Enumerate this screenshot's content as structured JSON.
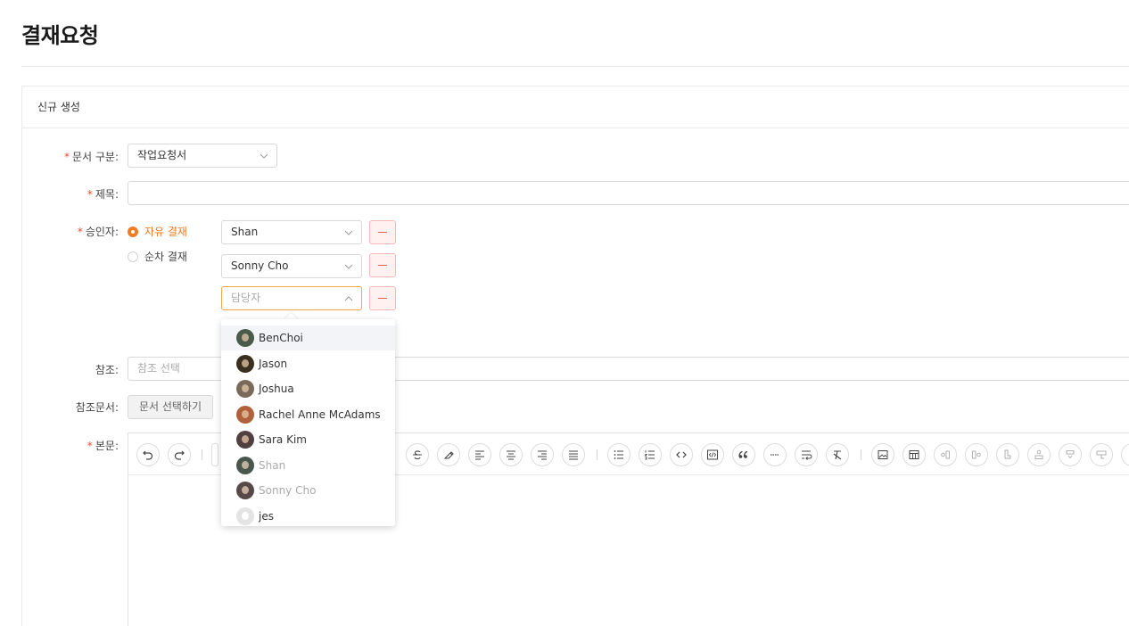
{
  "page_title": "결재요청",
  "card_header": "신규 생성",
  "form": {
    "doc_type_label": "문서 구분:",
    "doc_type_value": "작업요청서",
    "title_label": "제목:",
    "title_value": "",
    "approver_label": "승인자:",
    "approval_modes": [
      {
        "label": "자유 결재",
        "checked": true
      },
      {
        "label": "순차 결재",
        "checked": false
      }
    ],
    "approvers": [
      {
        "value": "Shan"
      },
      {
        "value": "Sonny Cho"
      },
      {
        "placeholder": "담당자"
      }
    ],
    "reference_label": "참조:",
    "reference_placeholder": "참조 선택",
    "ref_doc_label": "참조문서:",
    "ref_doc_button": "문서 선택하기",
    "body_label": "본문:",
    "required_mark": "*"
  },
  "dropdown": {
    "items": [
      {
        "name": "BenChoi",
        "state": "hover",
        "avatar_color": "#4a5a4a"
      },
      {
        "name": "Jason",
        "state": "normal",
        "avatar_color": "#3a3020"
      },
      {
        "name": "Joshua",
        "state": "normal",
        "avatar_color": "#7a6a5a"
      },
      {
        "name": "Rachel Anne McAdams",
        "state": "normal",
        "avatar_color": "#b0603a"
      },
      {
        "name": "Sara Kim",
        "state": "normal",
        "avatar_color": "#504040"
      },
      {
        "name": "Shan",
        "state": "disabled",
        "avatar_color": "#2a3a30"
      },
      {
        "name": "Sonny Cho",
        "state": "disabled",
        "avatar_color": "#3a2a2a"
      },
      {
        "name": "jes",
        "state": "normal",
        "avatar_color": "#e4e4e4"
      }
    ]
  },
  "colors": {
    "accent": "#f37b21",
    "danger": "#e06060"
  },
  "toolbar_icons": [
    "undo-icon",
    "redo-icon",
    "strikethrough-icon",
    "highlighter-icon",
    "align-left-icon",
    "align-center-icon",
    "align-right-icon",
    "align-justify-icon",
    "bullet-list-icon",
    "numbered-list-icon",
    "code-icon",
    "code-block-icon",
    "blockquote-icon",
    "horizontal-rule-icon",
    "wrap-text-icon",
    "clear-format-icon",
    "image-icon",
    "table-icon",
    "insert-column-right-icon",
    "insert-column-left-icon",
    "insert-row-after-icon",
    "insert-row-before-icon",
    "merge-cells-icon",
    "split-cells-icon"
  ]
}
